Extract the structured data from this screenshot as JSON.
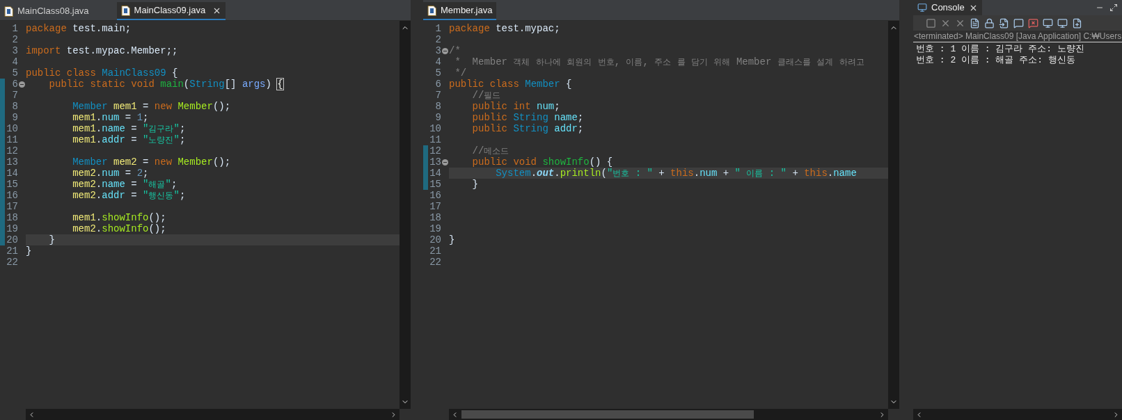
{
  "editors": [
    {
      "tabs": [
        {
          "label": "MainClass08.java",
          "selected": false
        },
        {
          "label": "MainClass09.java",
          "selected": true
        }
      ],
      "lines": [
        {
          "number": "1",
          "current": false,
          "fold": false,
          "changed": false,
          "tokens": [
            {
              "text": "package",
              "kind": "kw"
            },
            {
              "text": " test.main;",
              "kind": "plain"
            }
          ]
        },
        {
          "number": "2",
          "current": false,
          "fold": false,
          "changed": false
        },
        {
          "number": "3",
          "current": false,
          "fold": false,
          "changed": false,
          "tokens": [
            {
              "text": "import",
              "kind": "kw"
            },
            {
              "text": " test.mypac.Member;;",
              "kind": "plain"
            }
          ]
        },
        {
          "number": "4",
          "current": false,
          "fold": false,
          "changed": false
        },
        {
          "number": "5",
          "current": false,
          "fold": false,
          "changed": false,
          "tokens": [
            {
              "text": "public class",
              "kind": "kw"
            },
            {
              "text": " MainClass09",
              "kind": "type"
            },
            {
              "text": " {",
              "kind": "plain"
            }
          ]
        },
        {
          "number": "6",
          "current": false,
          "fold": true,
          "changed": true,
          "tokens": [
            {
              "text": "    public static void",
              "kind": "kw"
            },
            {
              "text": " main",
              "kind": "decl"
            },
            {
              "text": "(",
              "kind": "plain"
            },
            {
              "text": "String",
              "kind": "type"
            },
            {
              "text": "[]",
              "kind": "plain"
            },
            {
              "text": " args",
              "kind": "param"
            },
            {
              "text": ") ",
              "kind": "plain"
            },
            {
              "text": "{",
              "kind": "bracket"
            }
          ]
        },
        {
          "number": "7",
          "current": false,
          "fold": false,
          "changed": true
        },
        {
          "number": "8",
          "current": false,
          "fold": false,
          "changed": true,
          "tokens": [
            {
              "text": "        Member",
              "kind": "type"
            },
            {
              "text": " mem1",
              "kind": "local"
            },
            {
              "text": " =",
              "kind": "plain"
            },
            {
              "text": " new",
              "kind": "kw"
            },
            {
              "text": " Member",
              "kind": "call"
            },
            {
              "text": "();",
              "kind": "plain"
            }
          ]
        },
        {
          "number": "9",
          "current": false,
          "fold": false,
          "changed": true,
          "tokens": [
            {
              "text": "        mem1",
              "kind": "local"
            },
            {
              "text": ".",
              "kind": "plain"
            },
            {
              "text": "num",
              "kind": "field"
            },
            {
              "text": " =",
              "kind": "plain"
            },
            {
              "text": " 1",
              "kind": "number"
            },
            {
              "text": ";",
              "kind": "plain"
            }
          ]
        },
        {
          "number": "10",
          "current": false,
          "fold": false,
          "changed": true,
          "tokens": [
            {
              "text": "        mem1",
              "kind": "local"
            },
            {
              "text": ".",
              "kind": "plain"
            },
            {
              "text": "name",
              "kind": "field"
            },
            {
              "text": " =",
              "kind": "plain"
            },
            {
              "text": " \"김구라\"",
              "kind": "string"
            },
            {
              "text": ";",
              "kind": "plain"
            }
          ]
        },
        {
          "number": "11",
          "current": false,
          "fold": false,
          "changed": true,
          "tokens": [
            {
              "text": "        mem1",
              "kind": "local"
            },
            {
              "text": ".",
              "kind": "plain"
            },
            {
              "text": "addr",
              "kind": "field"
            },
            {
              "text": " =",
              "kind": "plain"
            },
            {
              "text": " \"노량진\"",
              "kind": "string"
            },
            {
              "text": ";",
              "kind": "plain"
            }
          ]
        },
        {
          "number": "12",
          "current": false,
          "fold": false,
          "changed": true
        },
        {
          "number": "13",
          "current": false,
          "fold": false,
          "changed": true,
          "tokens": [
            {
              "text": "        Member",
              "kind": "type"
            },
            {
              "text": " mem2",
              "kind": "local"
            },
            {
              "text": " =",
              "kind": "plain"
            },
            {
              "text": " new",
              "kind": "kw"
            },
            {
              "text": " Member",
              "kind": "call"
            },
            {
              "text": "();",
              "kind": "plain"
            }
          ]
        },
        {
          "number": "14",
          "current": false,
          "fold": false,
          "changed": true,
          "tokens": [
            {
              "text": "        mem2",
              "kind": "local"
            },
            {
              "text": ".",
              "kind": "plain"
            },
            {
              "text": "num",
              "kind": "field"
            },
            {
              "text": " =",
              "kind": "plain"
            },
            {
              "text": " 2",
              "kind": "number"
            },
            {
              "text": ";",
              "kind": "plain"
            }
          ]
        },
        {
          "number": "15",
          "current": false,
          "fold": false,
          "changed": true,
          "tokens": [
            {
              "text": "        mem2",
              "kind": "local"
            },
            {
              "text": ".",
              "kind": "plain"
            },
            {
              "text": "name",
              "kind": "field"
            },
            {
              "text": " =",
              "kind": "plain"
            },
            {
              "text": " \"해골\"",
              "kind": "string"
            },
            {
              "text": ";",
              "kind": "plain"
            }
          ]
        },
        {
          "number": "16",
          "current": false,
          "fold": false,
          "changed": true,
          "tokens": [
            {
              "text": "        mem2",
              "kind": "local"
            },
            {
              "text": ".",
              "kind": "plain"
            },
            {
              "text": "addr",
              "kind": "field"
            },
            {
              "text": " =",
              "kind": "plain"
            },
            {
              "text": " \"행신동\"",
              "kind": "string"
            },
            {
              "text": ";",
              "kind": "plain"
            }
          ]
        },
        {
          "number": "17",
          "current": false,
          "fold": false,
          "changed": true
        },
        {
          "number": "18",
          "current": false,
          "fold": false,
          "changed": true,
          "tokens": [
            {
              "text": "        mem1",
              "kind": "local"
            },
            {
              "text": ".",
              "kind": "plain"
            },
            {
              "text": "showInfo",
              "kind": "call"
            },
            {
              "text": "();",
              "kind": "plain"
            }
          ]
        },
        {
          "number": "19",
          "current": false,
          "fold": false,
          "changed": true,
          "tokens": [
            {
              "text": "        mem2",
              "kind": "local"
            },
            {
              "text": ".",
              "kind": "plain"
            },
            {
              "text": "showInfo",
              "kind": "call"
            },
            {
              "text": "();",
              "kind": "plain"
            }
          ]
        },
        {
          "number": "20",
          "current": true,
          "fold": false,
          "changed": true,
          "tokens": [
            {
              "text": "    }",
              "kind": "plain"
            }
          ]
        },
        {
          "number": "21",
          "current": false,
          "fold": false,
          "changed": false,
          "tokens": [
            {
              "text": "}",
              "kind": "plain"
            }
          ]
        },
        {
          "number": "22",
          "current": false,
          "fold": false,
          "changed": false
        }
      ]
    },
    {
      "tabs": [
        {
          "label": "Member.java",
          "selected": true
        }
      ],
      "lines": [
        {
          "number": "1",
          "current": false,
          "fold": false,
          "changed": false,
          "tokens": [
            {
              "text": "package",
              "kind": "kw"
            },
            {
              "text": " test.mypac;",
              "kind": "plain"
            }
          ]
        },
        {
          "number": "2",
          "current": false,
          "fold": false,
          "changed": false
        },
        {
          "number": "3",
          "current": false,
          "fold": true,
          "changed": false,
          "tokens": [
            {
              "text": "/*",
              "kind": "comment"
            }
          ]
        },
        {
          "number": "4",
          "current": false,
          "fold": false,
          "changed": false,
          "tokens": [
            {
              "text": " *  Member 객체 하나에 회원의 번호, 이름, 주소 를 담기 위해 Member 클래스를 설계 하려고",
              "kind": "comment"
            }
          ]
        },
        {
          "number": "5",
          "current": false,
          "fold": false,
          "changed": false,
          "tokens": [
            {
              "text": " */",
              "kind": "comment"
            }
          ]
        },
        {
          "number": "6",
          "current": false,
          "fold": false,
          "changed": false,
          "tokens": [
            {
              "text": "public class",
              "kind": "kw"
            },
            {
              "text": " Member",
              "kind": "type"
            },
            {
              "text": " {",
              "kind": "plain"
            }
          ]
        },
        {
          "number": "7",
          "current": false,
          "fold": false,
          "changed": false,
          "tokens": [
            {
              "text": "    //필드",
              "kind": "comment"
            }
          ]
        },
        {
          "number": "8",
          "current": false,
          "fold": false,
          "changed": false,
          "tokens": [
            {
              "text": "    public int",
              "kind": "kw"
            },
            {
              "text": " num",
              "kind": "field"
            },
            {
              "text": ";",
              "kind": "plain"
            }
          ]
        },
        {
          "number": "9",
          "current": false,
          "fold": false,
          "changed": false,
          "tokens": [
            {
              "text": "    public",
              "kind": "kw"
            },
            {
              "text": " String",
              "kind": "type"
            },
            {
              "text": " name",
              "kind": "field"
            },
            {
              "text": ";",
              "kind": "plain"
            }
          ]
        },
        {
          "number": "10",
          "current": false,
          "fold": false,
          "changed": false,
          "tokens": [
            {
              "text": "    public",
              "kind": "kw"
            },
            {
              "text": " String",
              "kind": "type"
            },
            {
              "text": " addr",
              "kind": "field"
            },
            {
              "text": ";",
              "kind": "plain"
            }
          ]
        },
        {
          "number": "11",
          "current": false,
          "fold": false,
          "changed": false
        },
        {
          "number": "12",
          "current": false,
          "fold": false,
          "changed": true,
          "tokens": [
            {
              "text": "    //메소드",
              "kind": "comment"
            }
          ]
        },
        {
          "number": "13",
          "current": false,
          "fold": true,
          "changed": true,
          "tokens": [
            {
              "text": "    public void",
              "kind": "kw"
            },
            {
              "text": " showInfo",
              "kind": "decl"
            },
            {
              "text": "() {",
              "kind": "plain"
            }
          ]
        },
        {
          "number": "14",
          "current": true,
          "fold": false,
          "changed": true,
          "tokens": [
            {
              "text": "        System",
              "kind": "type"
            },
            {
              "text": ".",
              "kind": "plain"
            },
            {
              "text": "out",
              "kind": "static"
            },
            {
              "text": ".",
              "kind": "plain"
            },
            {
              "text": "println",
              "kind": "call"
            },
            {
              "text": "(",
              "kind": "plain"
            },
            {
              "text": "\"번호 : \"",
              "kind": "string"
            },
            {
              "text": " +",
              "kind": "plain"
            },
            {
              "text": " this",
              "kind": "kw"
            },
            {
              "text": ".",
              "kind": "plain"
            },
            {
              "text": "num",
              "kind": "field"
            },
            {
              "text": " +",
              "kind": "plain"
            },
            {
              "text": " \" 이름 : \"",
              "kind": "string"
            },
            {
              "text": " +",
              "kind": "plain"
            },
            {
              "text": " this",
              "kind": "kw"
            },
            {
              "text": ".",
              "kind": "plain"
            },
            {
              "text": "name",
              "kind": "field"
            }
          ]
        },
        {
          "number": "15",
          "current": false,
          "fold": false,
          "changed": true,
          "tokens": [
            {
              "text": "    }",
              "kind": "plain"
            }
          ]
        },
        {
          "number": "16",
          "current": false,
          "fold": false,
          "changed": false
        },
        {
          "number": "17",
          "current": false,
          "fold": false,
          "changed": false
        },
        {
          "number": "18",
          "current": false,
          "fold": false,
          "changed": false
        },
        {
          "number": "19",
          "current": false,
          "fold": false,
          "changed": false
        },
        {
          "number": "20",
          "current": false,
          "fold": false,
          "changed": false,
          "tokens": [
            {
              "text": "}",
              "kind": "plain"
            }
          ]
        },
        {
          "number": "21",
          "current": false,
          "fold": false,
          "changed": false
        },
        {
          "number": "22",
          "current": false,
          "fold": false,
          "changed": false
        }
      ]
    }
  ],
  "console": {
    "tab": {
      "label": "Console",
      "selected": true
    },
    "header": "<terminated> MainClass09 [Java Application] C:₩Users",
    "output": [
      "번호 : 1 이름 : 김구라 주소: 노량진",
      "번호 : 2 이름 : 해골 주소: 행신동"
    ]
  }
}
